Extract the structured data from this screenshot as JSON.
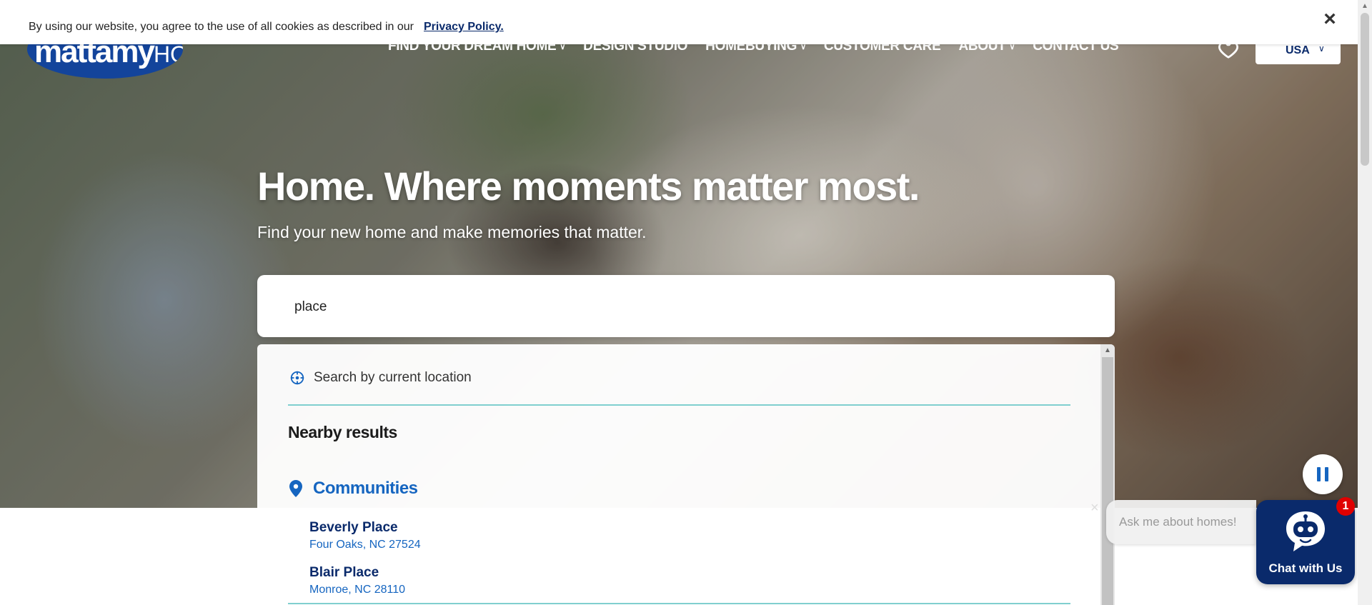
{
  "cookie": {
    "text": "By using our website, you agree to the use of all cookies as described in our",
    "link": "Privacy Policy.",
    "close": "×"
  },
  "header": {
    "logo_main": "mattamy",
    "logo_suffix": "HOMES",
    "nav": [
      {
        "label": "FIND YOUR DREAM HOME",
        "has_dropdown": true
      },
      {
        "label": "DESIGN STUDIO",
        "has_dropdown": false
      },
      {
        "label": "HOMEBUYING",
        "has_dropdown": true
      },
      {
        "label": "CUSTOMER CARE",
        "has_dropdown": false
      },
      {
        "label": "ABOUT",
        "has_dropdown": true
      },
      {
        "label": "CONTACT US",
        "has_dropdown": false
      }
    ],
    "favorites_icon": "heart-icon",
    "country": "USA"
  },
  "hero": {
    "headline": "Home. Where moments matter most.",
    "subhead": "Find your new home and make memories that matter."
  },
  "search": {
    "value": "place",
    "current_location_label": "Search by current location",
    "nearby_heading": "Nearby results",
    "category": "Communities",
    "results": [
      {
        "name": "Beverly Place",
        "address": "Four Oaks, NC 27524"
      },
      {
        "name": "Blair Place",
        "address": "Monroe, NC 28110"
      }
    ]
  },
  "chat": {
    "prompt": "Ask me about homes!",
    "button_label": "Chat with Us",
    "badge_count": "1",
    "close": "×"
  },
  "colors": {
    "navy": "#0a2a6b",
    "link_blue": "#1565c0",
    "divider_teal": "#7fcfcf",
    "badge_red": "#e00000"
  }
}
